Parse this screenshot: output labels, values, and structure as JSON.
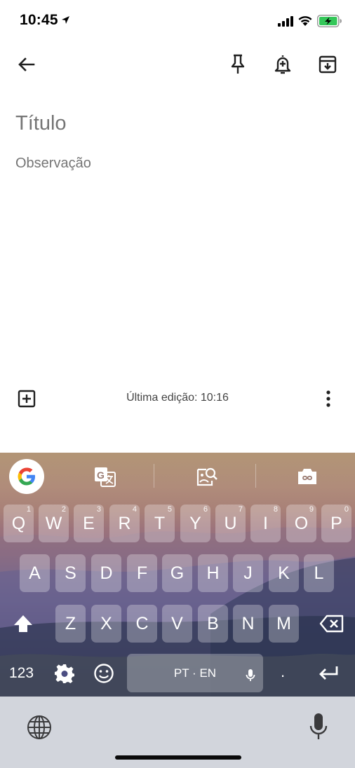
{
  "status_bar": {
    "time": "10:45"
  },
  "note": {
    "title_placeholder": "Título",
    "body_placeholder": "Observação",
    "last_edited": "Última edição: 10:16"
  },
  "keyboard": {
    "row1": [
      {
        "letter": "Q",
        "num": "1"
      },
      {
        "letter": "W",
        "num": "2"
      },
      {
        "letter": "E",
        "num": "3"
      },
      {
        "letter": "R",
        "num": "4"
      },
      {
        "letter": "T",
        "num": "5"
      },
      {
        "letter": "Y",
        "num": "6"
      },
      {
        "letter": "U",
        "num": "7"
      },
      {
        "letter": "I",
        "num": "8"
      },
      {
        "letter": "O",
        "num": "9"
      },
      {
        "letter": "P",
        "num": "0"
      }
    ],
    "row2": [
      "A",
      "S",
      "D",
      "F",
      "G",
      "H",
      "J",
      "K",
      "L"
    ],
    "row3": [
      "Z",
      "X",
      "C",
      "V",
      "B",
      "N",
      "M"
    ],
    "numbers_key": "123",
    "space_label": "PT · EN",
    "period_key": "."
  },
  "colors": {
    "accent_text": "#444444",
    "placeholder": "#9e9e9e",
    "battery": "#34c759"
  },
  "icons": [
    "location-arrow-icon",
    "signal-icon",
    "wifi-icon",
    "battery-charging-icon",
    "back-arrow-icon",
    "pin-icon",
    "reminder-bell-icon",
    "archive-icon",
    "add-box-icon",
    "more-vert-icon",
    "google-g-icon",
    "translate-icon",
    "lens-search-icon",
    "gif-camera-icon",
    "shift-icon",
    "backspace-icon",
    "settings-gear-icon",
    "emoji-icon",
    "mic-icon",
    "enter-icon",
    "globe-icon"
  ]
}
